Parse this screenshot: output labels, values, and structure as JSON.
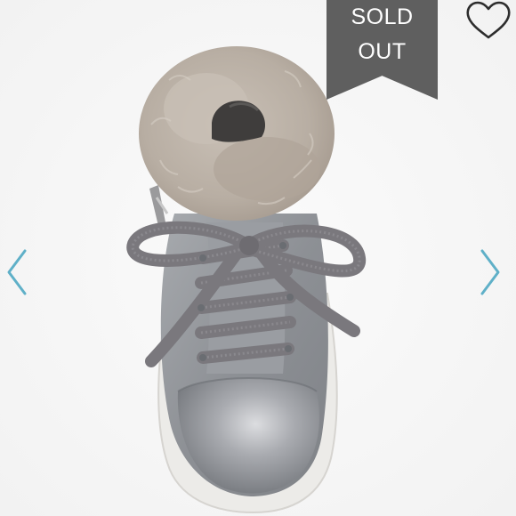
{
  "listing": {
    "badge": {
      "line1": "SOLD",
      "line2": "OUT"
    }
  },
  "icons": {
    "like": "heart-outline-icon",
    "previous": "chevron-left-icon",
    "next": "chevron-right-icon"
  },
  "colors": {
    "badge_bg": "#5f5f5f",
    "badge_text": "#ffffff",
    "arrow": "#5fb0c8",
    "heart": "#2d2d2d",
    "fur": "#bdb3a9",
    "suede": "#8f9297",
    "laces": "#7a787d"
  }
}
